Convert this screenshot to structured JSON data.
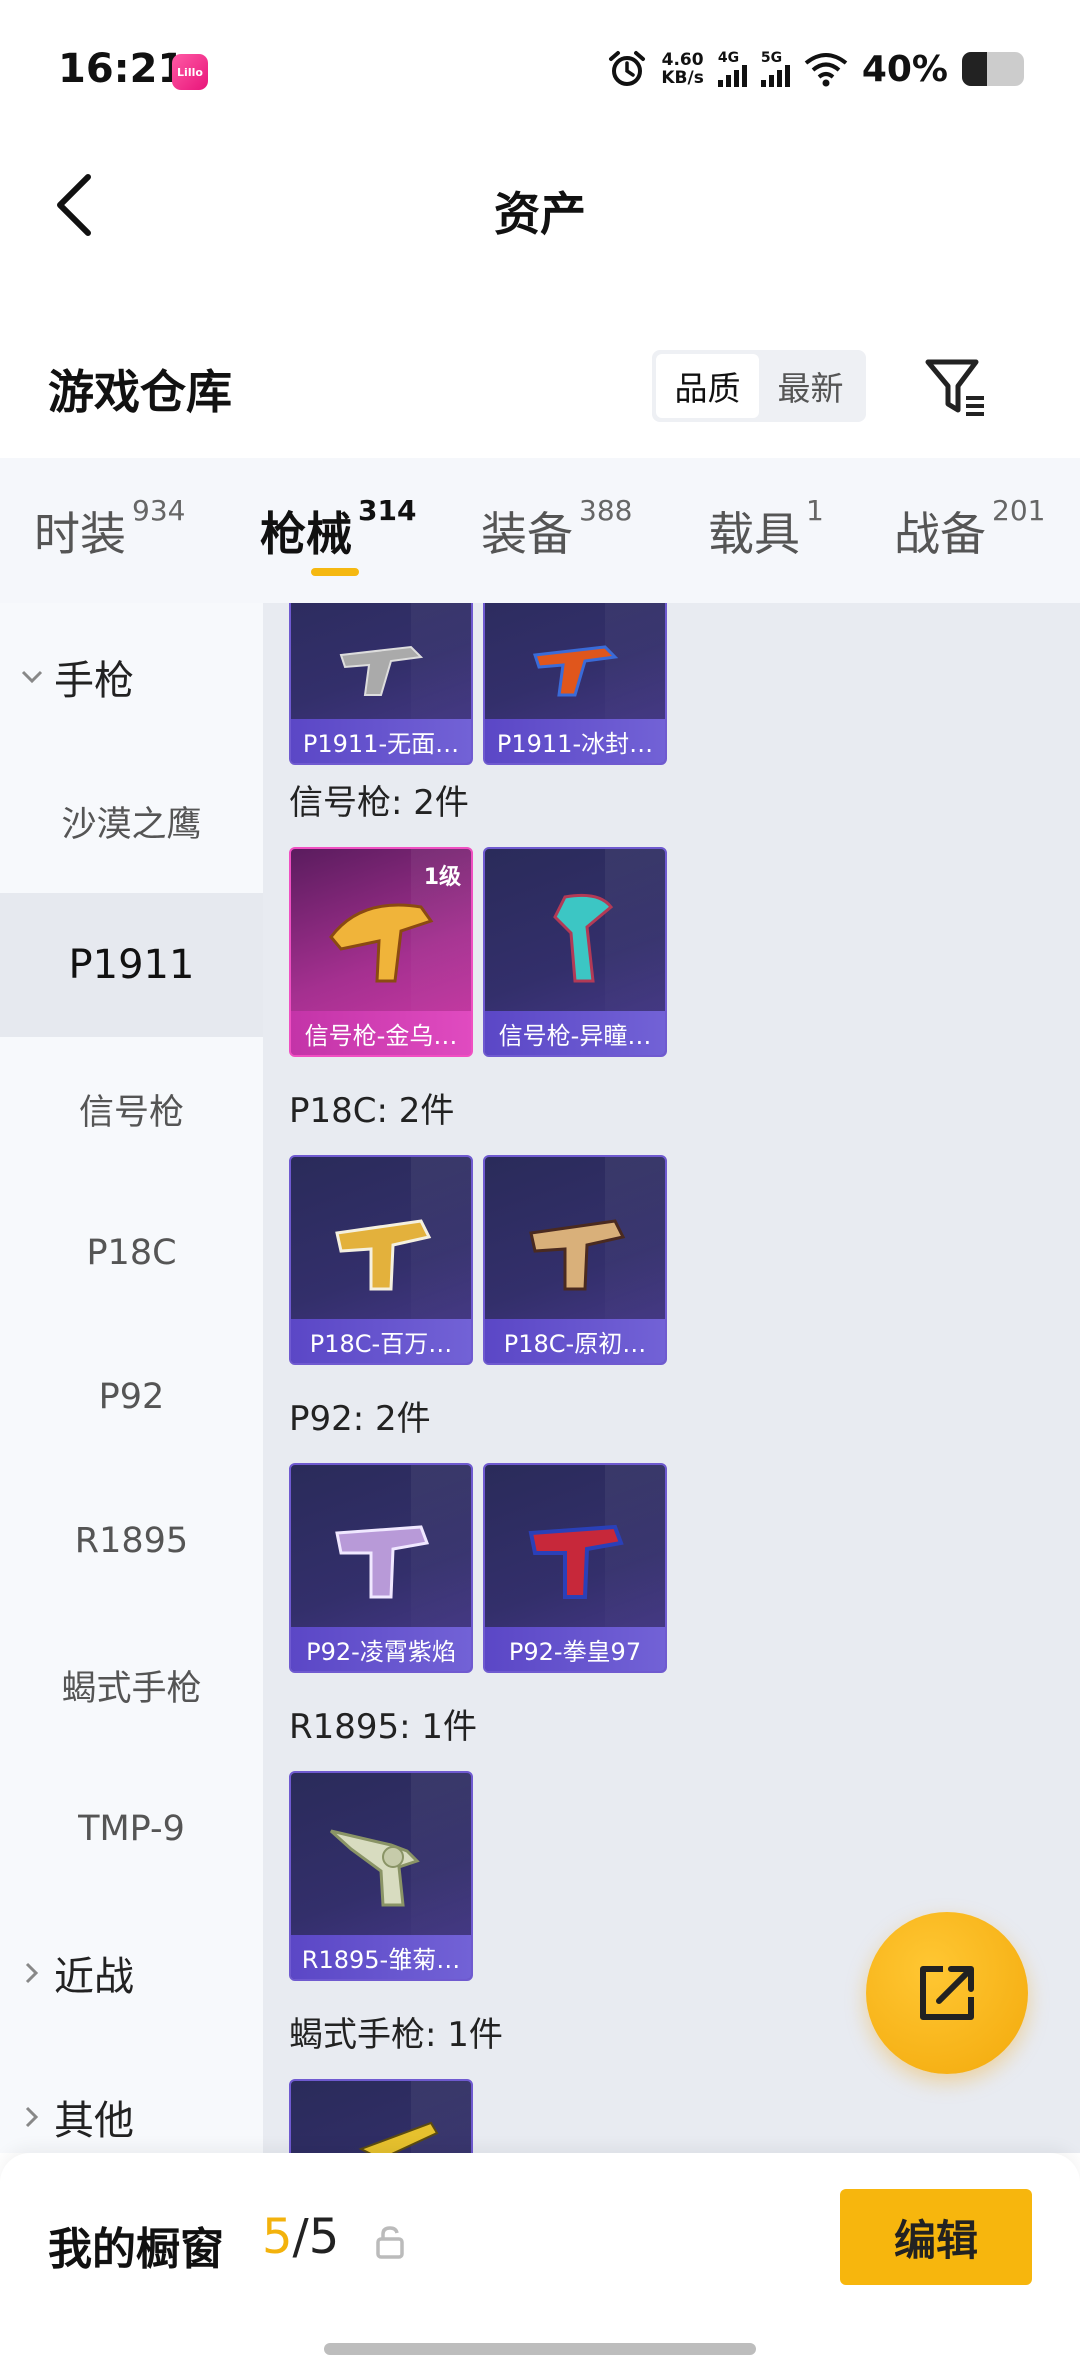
{
  "status_bar": {
    "time": "16:21",
    "app_badge": "Lillo",
    "net_speed_value": "4.60",
    "net_speed_unit": "KB/s",
    "signal_1": "4G",
    "signal_2": "5G",
    "battery_percent": "40%"
  },
  "header": {
    "title": "资产"
  },
  "warehouse": {
    "title": "游戏仓库",
    "sort_options": [
      "品质",
      "最新"
    ],
    "selected_sort": "品质"
  },
  "tabs": [
    {
      "label": "时装",
      "count": "934"
    },
    {
      "label": "枪械",
      "count": "314",
      "active": true
    },
    {
      "label": "装备",
      "count": "388"
    },
    {
      "label": "载具",
      "count": "1"
    },
    {
      "label": "战备",
      "count": "201"
    }
  ],
  "sidebar": {
    "category_pistol": "手枪",
    "items": [
      "沙漠之鹰",
      "P1911",
      "信号枪",
      "P18C",
      "P92",
      "R1895",
      "蝎式手枪",
      "TMP-9"
    ],
    "active_item": "P1911",
    "category_melee": "近战",
    "category_other": "其他"
  },
  "groups": [
    {
      "label": "",
      "items": [
        {
          "name": "P1911-无面…"
        },
        {
          "name": "P1911-冰封…"
        }
      ]
    },
    {
      "label": "信号枪: 2件",
      "items": [
        {
          "name": "信号枪-金乌…",
          "level": "1级",
          "rarity": "gold"
        },
        {
          "name": "信号枪-异瞳…"
        }
      ]
    },
    {
      "label": "P18C: 2件",
      "items": [
        {
          "name": "P18C-百万…"
        },
        {
          "name": "P18C-原初…"
        }
      ]
    },
    {
      "label": "P92: 2件",
      "items": [
        {
          "name": "P92-凌霄紫焰"
        },
        {
          "name": "P92-拳皇97"
        }
      ]
    },
    {
      "label": "R1895: 1件",
      "items": [
        {
          "name": "R1895-雏菊…"
        }
      ]
    },
    {
      "label": "蝎式手枪: 1件",
      "items": []
    }
  ],
  "bottom_bar": {
    "showcase_label": "我的橱窗",
    "showcase_current": "5",
    "showcase_total": "/5",
    "edit_label": "编辑"
  },
  "colors": {
    "accent": "#f7b60d",
    "card_purple": "#332f6b",
    "card_gold": "#d03aa8"
  }
}
